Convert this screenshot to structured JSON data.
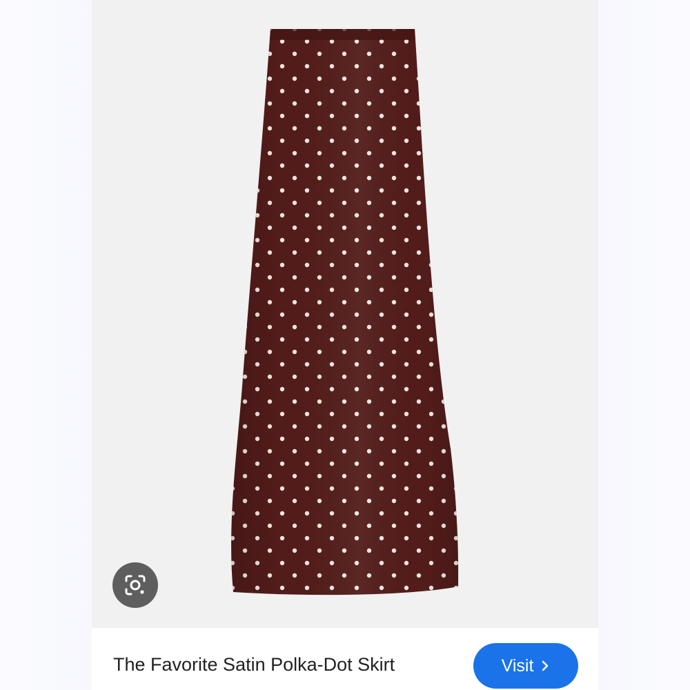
{
  "product": {
    "title": "The Favorite Satin Polka-Dot Skirt",
    "image_subject": "polka-dot-maxi-skirt",
    "skirt_color": "#521c1a",
    "dot_color": "#f2e6e0"
  },
  "actions": {
    "visit_label": "Visit",
    "visit_color": "#1a73e8",
    "lens_icon": "google-lens-icon",
    "visit_chevron_icon": "chevron-right-icon"
  },
  "colors": {
    "photo_background": "#f1f1f1",
    "lens_button": "#5e5e5e"
  }
}
